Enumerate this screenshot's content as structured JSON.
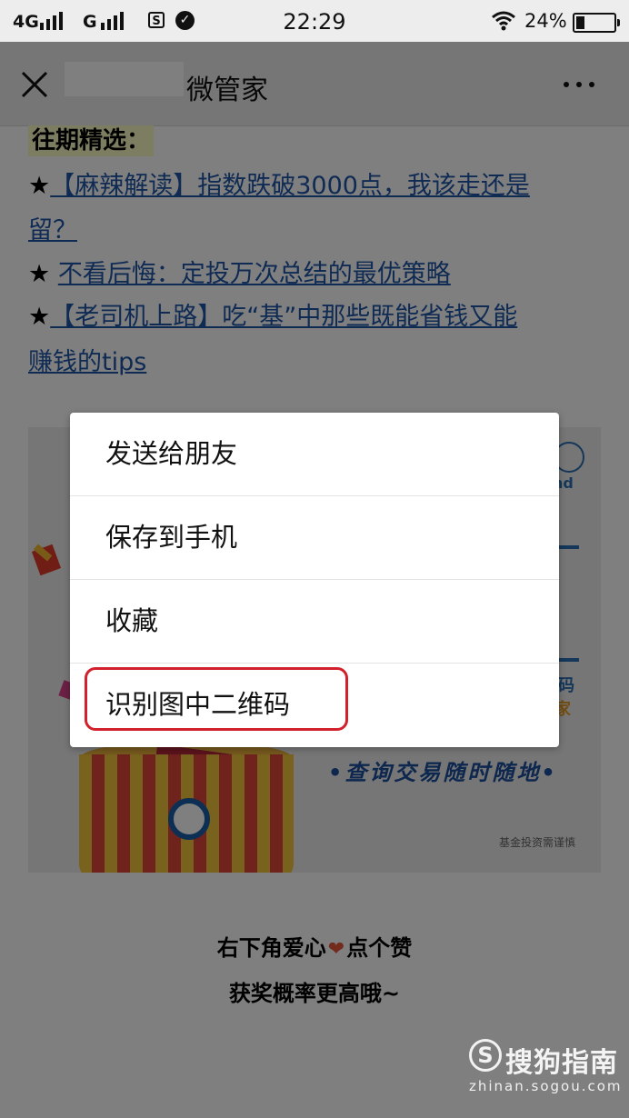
{
  "status_bar": {
    "network_1": "4G",
    "network_2": "G",
    "time": "22:29",
    "battery_percent": "24%",
    "battery_level": 0.24
  },
  "header": {
    "title_suffix": "微管家"
  },
  "article": {
    "section_title": "往期精选：",
    "star": "★",
    "link1_line1": "【麻辣解读】指数跌破3000点，我该走还是",
    "link1_line2": "留？",
    "link2": "不看后悔：定投万次总结的最优策略",
    "link3_line1": "【老司机上路】吃“基”中那些既能省钱又能",
    "link3_line2": "赚钱的tips"
  },
  "promo": {
    "nd_text": "nd",
    "qr_label_1": "码",
    "qr_label_2": "家",
    "slogan": "•查询交易随时随地•",
    "small_text": "基金投资需谨慎"
  },
  "footer": {
    "line1_before": "右下角爱心",
    "line1_after": "点个赞",
    "line2": "获奖概率更高哦~"
  },
  "menu": {
    "items": [
      {
        "label": "发送给朋友"
      },
      {
        "label": "保存到手机"
      },
      {
        "label": "收藏"
      },
      {
        "label": "识别图中二维码"
      }
    ],
    "highlight_color": "#d2202c"
  },
  "watermark": {
    "logo_letter": "S",
    "brand": "搜狗指南",
    "url": "zhinan.sogou.com"
  },
  "colors": {
    "link": "#1f56a8",
    "header_bg": "#ededed",
    "section_highlight": "#fbfcc3"
  }
}
